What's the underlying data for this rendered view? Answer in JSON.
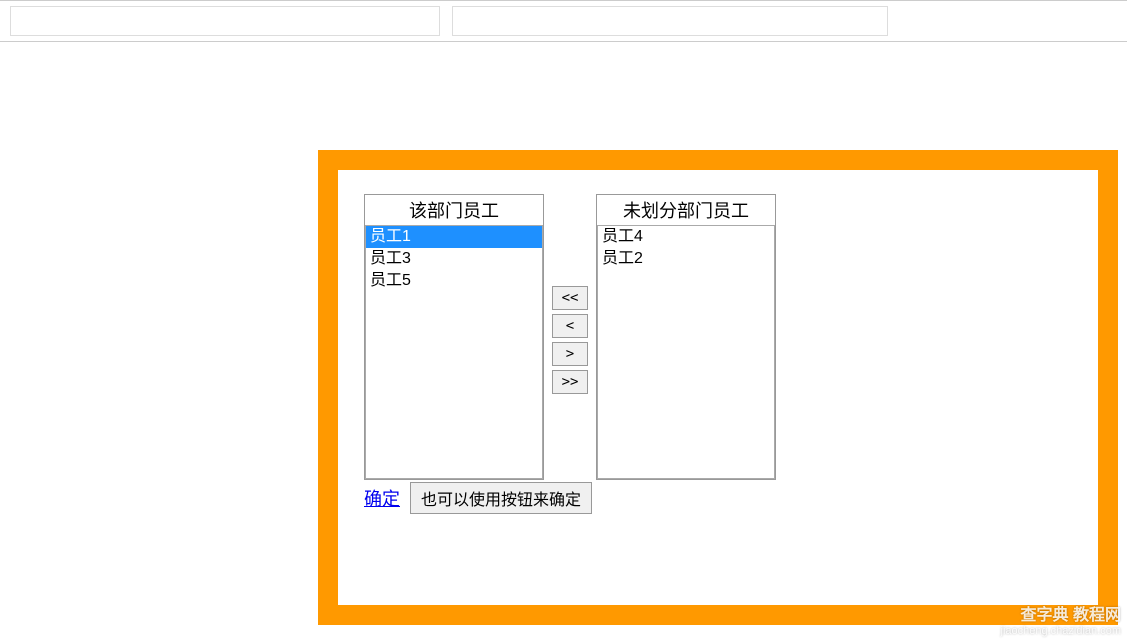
{
  "top_inputs": {
    "input1_value": "",
    "input2_value": ""
  },
  "transfer": {
    "left_title": "该部门员工",
    "right_title": "未划分部门员工",
    "left_items": [
      "员工1",
      "员工3",
      "员工5"
    ],
    "left_selected_index": 0,
    "right_items": [
      "员工4",
      "员工2"
    ],
    "buttons": {
      "move_all_left": "<<",
      "move_left": "<",
      "move_right": ">",
      "move_all_right": ">>"
    }
  },
  "actions": {
    "confirm_link": "确定",
    "confirm_button": "也可以使用按钮来确定"
  },
  "watermark": {
    "line1": "查字典 教程网",
    "line2": "jiaocheng.chazidian.com"
  }
}
